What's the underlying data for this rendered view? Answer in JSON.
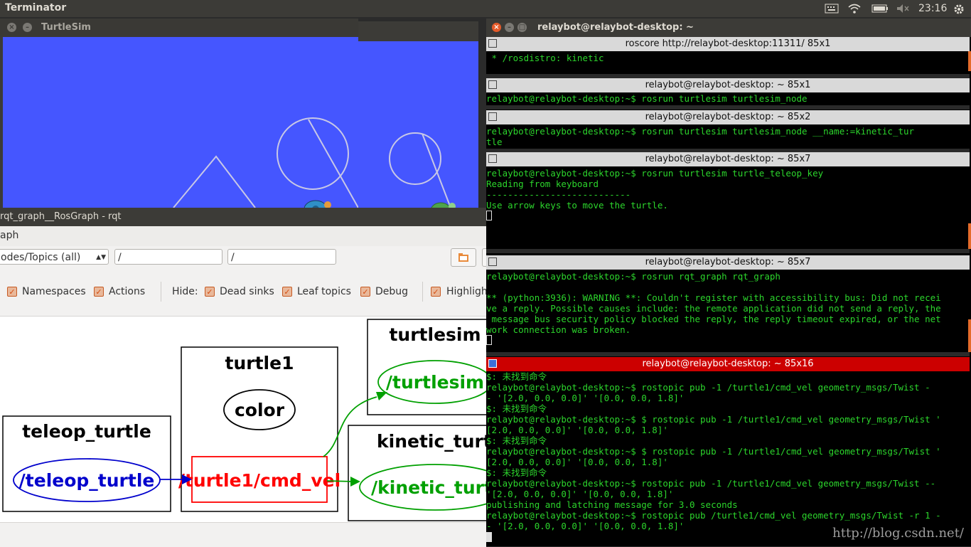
{
  "topbar": {
    "app_title": "Terminator",
    "clock": "23:16",
    "icons": [
      "keyboard-icon",
      "wifi-icon",
      "battery-icon",
      "volume-muted-icon",
      "gear-icon"
    ]
  },
  "turtlesim": {
    "window_title": "TurtleSim",
    "background_color": "#4556ff"
  },
  "rqt": {
    "window_title": "rqt_graph__RosGraph - rqt",
    "tab_label": "aph",
    "nodes_combo_value": "odes/Topics (all)",
    "ns_filter_value": "/",
    "topic_filter_value": "/",
    "group_checkboxes": [
      {
        "label": "Namespaces",
        "checked": true
      },
      {
        "label": "Actions",
        "checked": true
      }
    ],
    "hide_label": "Hide:",
    "hide_checkboxes": [
      {
        "label": "Dead sinks",
        "checked": true
      },
      {
        "label": "Leaf topics",
        "checked": true
      },
      {
        "label": "Debug",
        "checked": true
      }
    ],
    "highlight_checkbox": {
      "label": "Highligh",
      "checked": true
    },
    "graph": {
      "clusters": {
        "teleop": "teleop_turtle",
        "turtle1": "turtle1",
        "turtlesim": "turtlesim",
        "kinetic": "kinetic_turtle"
      },
      "nodes": {
        "teleop_node": "/teleop_turtle",
        "color_topic": "color",
        "cmd_vel_topic": "/turtle1/cmd_vel",
        "turtlesim_node": "/turtlesim",
        "kinetic_node": "/kinetic_turtle"
      },
      "colors": {
        "node_blue": "#0000cc",
        "topic_red": "#ff0000",
        "node_green": "#00a000"
      }
    }
  },
  "terminator": {
    "window_title": "relaybot@relaybot-desktop: ~",
    "panes": [
      {
        "title": "roscore http://relaybot-desktop:11311/ 85x1",
        "lines": [
          " * /rosdistro: kinetic"
        ]
      },
      {
        "title": "relaybot@relaybot-desktop: ~ 85x1",
        "lines": [
          "relaybot@relaybot-desktop:~$ rosrun turtlesim turtlesim_node"
        ]
      },
      {
        "title": "relaybot@relaybot-desktop: ~ 85x2",
        "lines": [
          "relaybot@relaybot-desktop:~$ rosrun turtlesim turtlesim_node __name:=kinetic_tur",
          "tle"
        ]
      },
      {
        "title": "relaybot@relaybot-desktop: ~ 85x7",
        "lines": [
          "relaybot@relaybot-desktop:~$ rosrun turtlesim turtle_teleop_key",
          "Reading from keyboard",
          "---------------------------",
          "Use arrow keys to move the turtle."
        ]
      },
      {
        "title": "relaybot@relaybot-desktop: ~ 85x7",
        "lines": [
          "relaybot@relaybot-desktop:~$ rosrun rqt_graph rqt_graph",
          "",
          "** (python:3936): WARNING **: Couldn't register with accessibility bus: Did not recei",
          "ve a reply. Possible causes include: the remote application did not send a reply, the",
          " message bus security policy blocked the reply, the reply timeout expired, or the net",
          "work connection was broken."
        ]
      },
      {
        "title": "relaybot@relaybot-desktop: ~ 85x16",
        "lines": [
          "$: 未找到命令",
          "relaybot@relaybot-desktop:~$ rostopic pub -1 /turtle1/cmd_vel geometry_msgs/Twist -",
          "- '[2.0, 0.0, 0.0]' '[0.0, 0.0, 1.8]'",
          "$: 未找到命令",
          "relaybot@relaybot-desktop:~$ $ rostopic pub -1 /turtle1/cmd_vel geometry_msgs/Twist '",
          "[2.0, 0.0, 0.0]' '[0.0, 0.0, 1.8]'",
          "$: 未找到命令",
          "relaybot@relaybot-desktop:~$ $ rostopic pub -1 /turtle1/cmd_vel geometry_msgs/Twist '",
          "[2.0, 0.0, 0.0]' '[0.0, 0.0, 1.8]'",
          "$: 未找到命令",
          "relaybot@relaybot-desktop:~$ rostopic pub -1 /turtle1/cmd_vel geometry_msgs/Twist --",
          "'[2.0, 0.0, 0.0]' '[0.0, 0.0, 1.8]'",
          "publishing and latching message for 3.0 seconds",
          "relaybot@relaybot-desktop:~$ rostopic pub /turtle1/cmd_vel geometry_msgs/Twist -r 1 -",
          "- '[2.0, 0.0, 0.0]' '[0.0, 0.0, 1.8]'"
        ]
      }
    ],
    "watermark": "http://blog.csdn.net/",
    "text_color": "#2cd52c",
    "active_pane_color": "#cc0000"
  }
}
